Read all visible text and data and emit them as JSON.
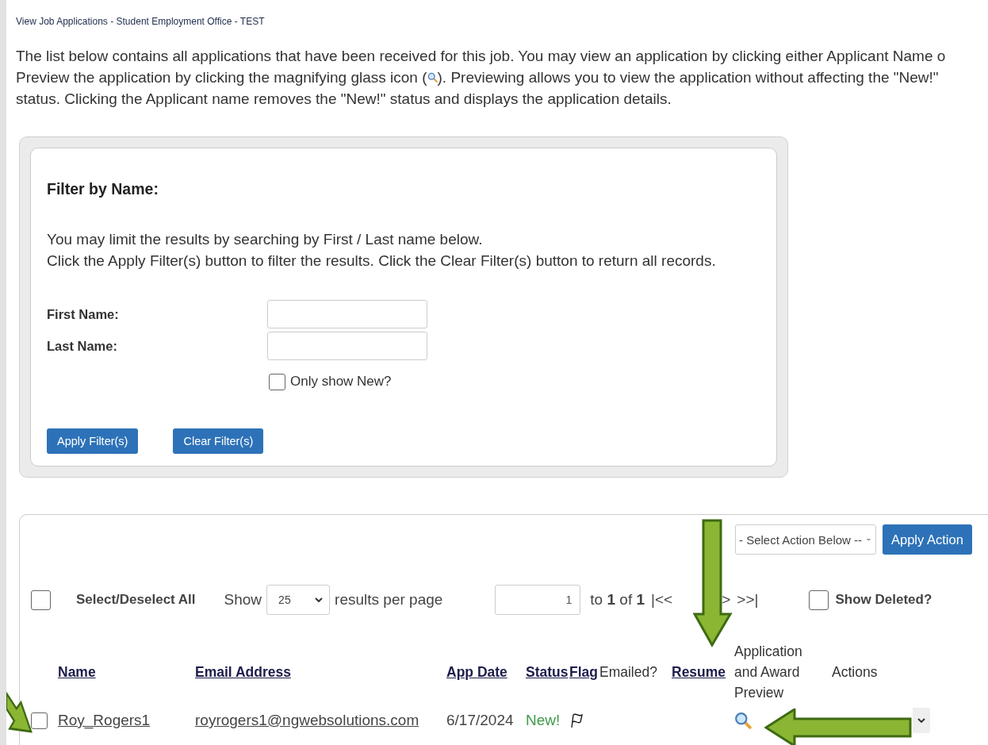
{
  "page_title": "View Job Applications - Student Employment Office - TEST",
  "intro": {
    "line_1": "The list below contains all applications that have been received for this job. You may view an application by clicking either Applicant Name o",
    "line_2_before_icon": "Preview the application by clicking the magnifying glass icon (",
    "line_2_after_icon": "). Previewing allows you to view the application without affecting the \"New!\"",
    "line_3": "status. Clicking the Applicant name removes the \"New!\" status and displays the application details."
  },
  "filter": {
    "heading": "Filter by Name:",
    "help": [
      "You may limit the results by searching by First / Last name below.",
      "Click the Apply Filter(s) button to filter the results. Click the Clear Filter(s) button to return all records."
    ],
    "fields": [
      {
        "label": "First Name:"
      },
      {
        "label": "Last Name:"
      }
    ],
    "only_new": {
      "label": "Only show New?",
      "checked": false
    },
    "buttons": [
      "Apply Filter(s)",
      "Clear Filter(s)"
    ]
  },
  "results": {
    "action_select": "- Select Action Below --",
    "apply_action": "Apply Action",
    "select_all": {
      "label": "Select/Deselect All",
      "checked": false
    },
    "show_label": "Show",
    "per_page": "25",
    "per_page_suffix": "results per page",
    "page_value": "1",
    "range": "to **1** of **1**",
    "nav": [
      "|<<",
      ">",
      ">>|"
    ],
    "show_deleted": {
      "label": "Show Deleted?",
      "checked": false
    },
    "columns": [
      {
        "label": "Name",
        "sortable": true
      },
      {
        "label": "Email Address",
        "sortable": true
      },
      {
        "label": "App Date",
        "sortable": true
      },
      {
        "label": "Status",
        "sortable": true
      },
      {
        "label": "Flag",
        "sortable": true
      },
      {
        "label": "Emailed?",
        "sortable": false
      },
      {
        "label": "Resume",
        "sortable": true
      },
      {
        "label": "Application and Award Preview",
        "sortable": false
      },
      {
        "label": "Actions",
        "sortable": false
      }
    ],
    "rows": [
      {
        "checked": false,
        "name": "Roy_Rogers1",
        "email": "royrogers1@ngwebsolutions.com",
        "date": "6/17/2024",
        "status": "New!"
      }
    ]
  }
}
